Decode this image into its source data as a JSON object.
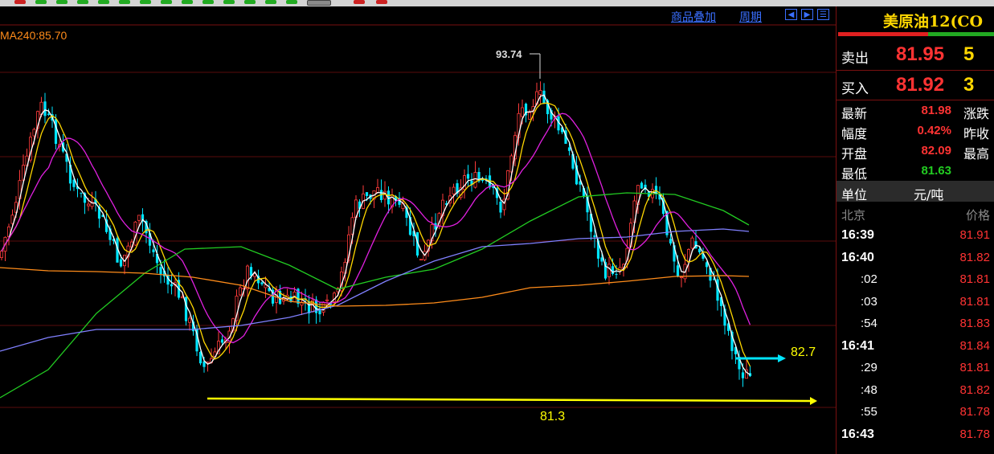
{
  "chart_toolbar": {
    "overlay_link": "商品叠加",
    "period_link": "周期"
  },
  "chart": {
    "ma_label": "MA240:85.70",
    "high_marker": "93.74",
    "resistance_label": "82.7",
    "support_label": "81.3",
    "colors": {
      "up": "#ff3b3b",
      "down": "#00e5ff",
      "ma5": "#ffffff",
      "ma10": "#ffd700",
      "ma20": "#e020e0",
      "ma60": "#22cc22",
      "ma120": "#8080ff",
      "ma240": "#ff8c1a",
      "annotation": "#ffff00"
    }
  },
  "quote_panel": {
    "title": "美原油12(CO",
    "sell": {
      "label": "卖出",
      "price": "81.95",
      "volume": "5"
    },
    "buy": {
      "label": "买入",
      "price": "81.92",
      "volume": "3"
    },
    "stats": [
      {
        "label": "最新",
        "value": "81.98",
        "color": "#ff3333",
        "label2": "涨跌"
      },
      {
        "label": "幅度",
        "value": "0.42%",
        "color": "#ff3333",
        "label2": "昨收"
      },
      {
        "label": "开盘",
        "value": "82.09",
        "color": "#ff3333",
        "label2": "最高"
      },
      {
        "label": "最低",
        "value": "81.63",
        "color": "#22cc22",
        "label2": ""
      }
    ],
    "unit": {
      "label": "单位",
      "value": "元/吨"
    },
    "ticks_header": {
      "left": "北京",
      "right": "价格"
    },
    "ticks": [
      {
        "time": "16:39",
        "price": "81.91",
        "major": true
      },
      {
        "time": "16:40",
        "price": "81.82",
        "major": true
      },
      {
        "time": ":02",
        "price": "81.81",
        "major": false
      },
      {
        "time": ":03",
        "price": "81.81",
        "major": false
      },
      {
        "time": ":54",
        "price": "81.83",
        "major": false
      },
      {
        "time": "16:41",
        "price": "81.84",
        "major": true
      },
      {
        "time": ":29",
        "price": "81.81",
        "major": false
      },
      {
        "time": ":48",
        "price": "81.82",
        "major": false
      },
      {
        "time": ":55",
        "price": "81.78",
        "major": false
      },
      {
        "time": "16:43",
        "price": "81.78",
        "major": true
      }
    ]
  }
}
